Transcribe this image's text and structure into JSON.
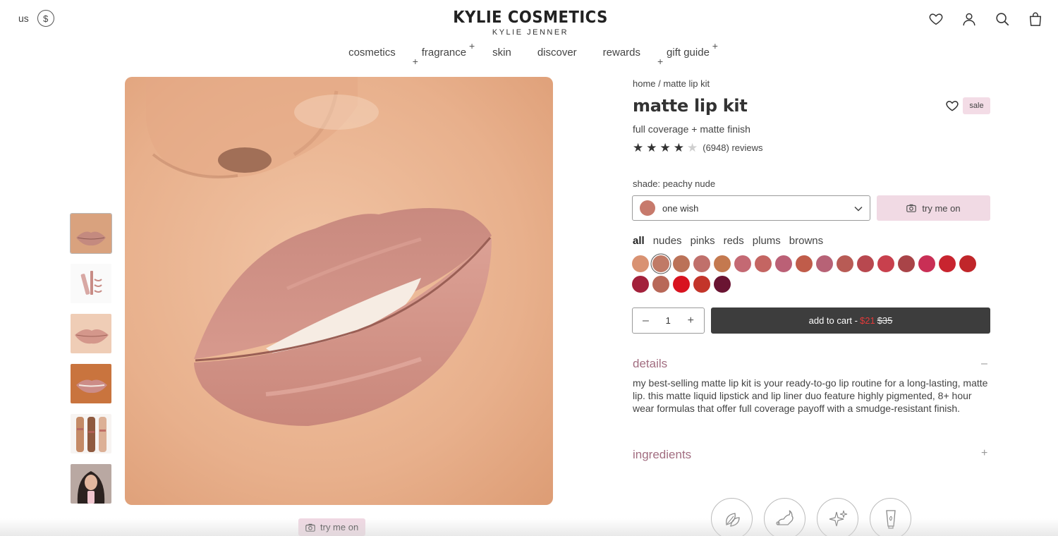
{
  "header": {
    "region": "us",
    "currency_icon": "$",
    "logo_main": "KYLIE COSMETICS",
    "logo_sub": "KYLIE JENNER",
    "icons": [
      "heart-icon",
      "account-icon",
      "search-icon",
      "bag-icon"
    ]
  },
  "nav": {
    "items": [
      "cosmetics",
      "fragrance",
      "skin",
      "discover",
      "rewards",
      "gift guide"
    ]
  },
  "gallery": {
    "thumbnails": [
      "lips-swatch",
      "lip-kit-product",
      "lips-closeup",
      "lips-tan",
      "arm-swatches",
      "model-photo"
    ],
    "try_me_on": "try me on"
  },
  "product": {
    "breadcrumb": "home / matte lip kit",
    "title": "matte lip kit",
    "badge": "sale",
    "subtitle": "full coverage + matte finish",
    "rating": 4,
    "reviews": "(6948) reviews",
    "shade_label": "shade: peachy nude",
    "selected_shade": "one wish",
    "selected_shade_color": "#c77a6c",
    "try_me_on": "try me on",
    "filters": [
      "all",
      "nudes",
      "pinks",
      "reds",
      "plums",
      "browns"
    ],
    "swatches": [
      "#d99272",
      "#c07a66",
      "#bb7258",
      "#c0706b",
      "#c4794f",
      "#c46973",
      "#c46562",
      "#bb6076",
      "#c05c4a",
      "#b76276",
      "#b85b55",
      "#b8484f",
      "#c8404d",
      "#a94448",
      "#c92f55",
      "#c8242f",
      "#c0262a",
      "#a3213b",
      "#b86858",
      "#d8131f",
      "#c3352a",
      "#6a1432"
    ],
    "selected_swatch": 1,
    "quantity": "1",
    "qty_minus": "–",
    "qty_plus": "+",
    "cart_label": "add to cart -",
    "price_sale": "$21",
    "price_original": "$35",
    "details_title": "details",
    "details_toggle": "–",
    "details_text": "my best-selling matte lip kit is your ready-to-go lip routine for a long-lasting, matte lip. this matte liquid lipstick and lip liner duo feature highly pigmented, 8+ hour wear formulas that offer full coverage payoff with a smudge-resistant finish.",
    "ingredients_title": "ingredients",
    "ingredients_toggle": "+",
    "badges": [
      "vegan-leaf-icon",
      "cruelty-free-bunny-icon",
      "sparkle-icon",
      "tube-icon"
    ]
  }
}
